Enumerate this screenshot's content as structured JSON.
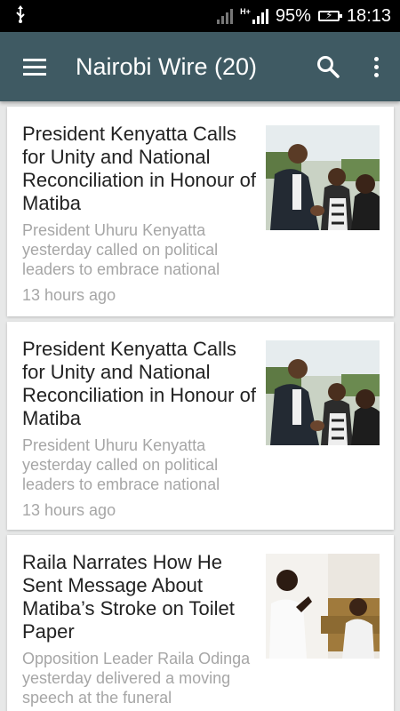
{
  "status_bar": {
    "usb_icon": "usb-icon",
    "network_type": "H+",
    "battery_percent": "95%",
    "time": "18:13"
  },
  "app_bar": {
    "title": "Nairobi Wire (20)",
    "menu_icon": "hamburger-menu-icon",
    "search_icon": "search-icon",
    "more_icon": "overflow-menu-icon",
    "color": "#3f5a63"
  },
  "articles": [
    {
      "title": "President Kenyatta Calls for Unity and National Reconciliation in Honour of Matiba",
      "summary": "President Uhuru Kenyatta yesterday called on political leaders to embrace national",
      "time": "13 hours ago"
    },
    {
      "title": "President Kenyatta Calls for Unity and National Reconciliation in Honour of Matiba",
      "summary": "President Uhuru Kenyatta yesterday called on political leaders to embrace national",
      "time": "13 hours ago"
    },
    {
      "title": "Raila Narrates How He Sent Message About Matiba’s Stroke on Toilet Paper",
      "summary": "Opposition Leader Raila Odinga yesterday delivered a moving speech at the funeral",
      "time": ""
    }
  ]
}
